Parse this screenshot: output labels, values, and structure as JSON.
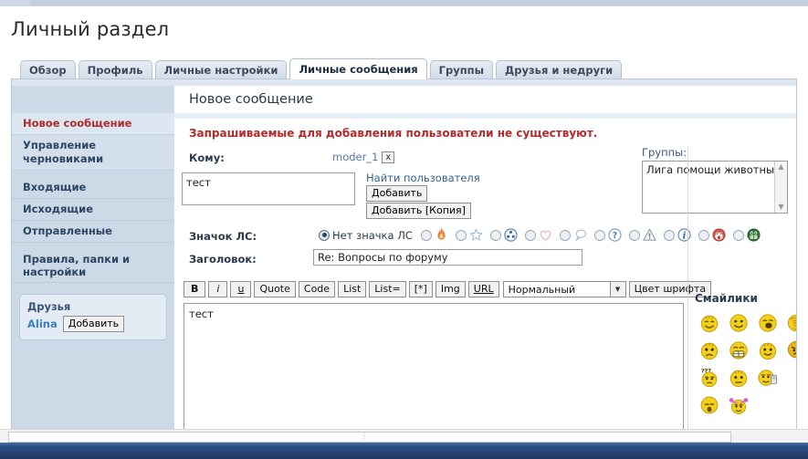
{
  "page": {
    "title": "Личный раздел"
  },
  "tabs": [
    {
      "label": "Обзор",
      "active": false
    },
    {
      "label": "Профиль",
      "active": false
    },
    {
      "label": "Личные настройки",
      "active": false
    },
    {
      "label": "Личные сообщения",
      "active": true
    },
    {
      "label": "Группы",
      "active": false
    },
    {
      "label": "Друзья и недруги",
      "active": false
    }
  ],
  "sidebar": {
    "items": [
      {
        "label": "Новое сообщение",
        "current": true
      },
      {
        "label": "Управление черновиками",
        "current": false
      },
      {
        "label": "Входящие",
        "current": false
      },
      {
        "label": "Исходящие",
        "current": false
      },
      {
        "label": "Отправленные",
        "current": false
      },
      {
        "label": "Правила, папки и настройки",
        "current": false
      }
    ],
    "friends": {
      "title": "Друзья",
      "name": "Alina",
      "add_label": "Добавить"
    }
  },
  "main": {
    "heading": "Новое сообщение",
    "error": "Запрашиваемые для добавления пользователи не существуют.",
    "to": {
      "label": "Кому:",
      "recipient": "moder_1",
      "remove_label": "x",
      "textarea_value": "тест",
      "find_user_link": "Найти пользователя",
      "add_label": "Добавить",
      "add_copy_label": "Добавить [Копия]"
    },
    "groups": {
      "label": "Группы:",
      "options": [
        "Лига помощи животным"
      ],
      "selected": "Лига помощи животным"
    },
    "pm_icon": {
      "label": "Значок ЛС:",
      "no_icon_label": "Нет значка ЛС",
      "selected_index": 0,
      "choices": [
        {
          "name": "no-icon",
          "color": ""
        },
        {
          "name": "flame-icon",
          "color": "#e8743b"
        },
        {
          "name": "star-icon",
          "color": "#aac3dd"
        },
        {
          "name": "radiation-icon",
          "color": "#7c9fd0"
        },
        {
          "name": "heart-icon",
          "color": "#f0b9c8"
        },
        {
          "name": "speech-bubble-icon",
          "color": "#b9c7dd"
        },
        {
          "name": "question-mark-icon",
          "color": "#7ea4cc"
        },
        {
          "name": "warning-triangle-icon",
          "color": "#8095ad"
        },
        {
          "name": "info-icon",
          "color": "#5b8fc9"
        },
        {
          "name": "sad-face-icon",
          "color": "#d9594f"
        },
        {
          "name": "grin-face-icon",
          "color": "#2f7a36"
        }
      ]
    },
    "subject": {
      "label": "Заголовок:",
      "value": "Re: Вопросы по форуму"
    },
    "toolbar": {
      "buttons": [
        "B",
        "i",
        "u",
        "Quote",
        "Code",
        "List",
        "List=",
        "[*]",
        "Img",
        "URL"
      ],
      "font_size_selected": "Нормальный",
      "font_color_label": "Цвет шрифта"
    },
    "message": {
      "value": "тест"
    },
    "smilies": {
      "title": "Смайлики",
      "items": [
        "smiley-wink-happy",
        "smiley-happy",
        "smiley-shout",
        "smiley-facepalm",
        "smiley-sad-brows",
        "smiley-big-grin",
        "smiley-smile-brows",
        "smiley-angry-fist",
        "smiley-confused",
        "smiley-neutral-brows",
        "smiley-talking-phone",
        "smiley-blank",
        "smiley-sleepy",
        "smiley-flower-girl",
        "smiley-blank",
        "smiley-blank"
      ]
    }
  },
  "colors": {
    "accent": "#2f4564",
    "error": "#b32b2b",
    "link": "#33628f",
    "sidebar_bg": "#ccd9e7",
    "tab_active_bg": "#ffffff",
    "taskbar": "#24406f"
  }
}
